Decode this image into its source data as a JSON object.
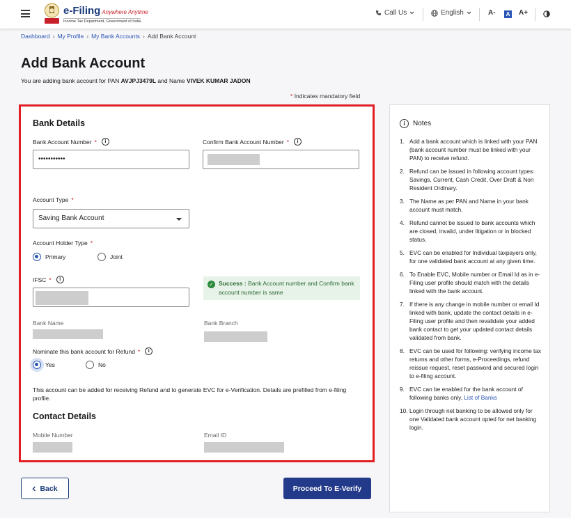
{
  "header": {
    "logo_title": "e-Filing",
    "logo_tagline": "Anywhere Anytime",
    "logo_subtitle": "Income Tax Department, Government of India",
    "call_us": "Call Us",
    "language": "English",
    "font_decrease": "A-",
    "font_normal": "A",
    "font_increase": "A+"
  },
  "breadcrumb": {
    "items": [
      "Dashboard",
      "My Profile",
      "My Bank Accounts"
    ],
    "current": "Add Bank Account"
  },
  "page": {
    "title": "Add Bank Account",
    "intro_prefix": "You are adding bank account for PAN ",
    "pan": "AVJPJ3479L",
    "intro_mid": " and Name ",
    "name": "VIVEK KUMAR JADON",
    "mandatory_note": "Indicates mandatory field"
  },
  "form": {
    "bank_details_title": "Bank Details",
    "account_number_label": "Bank Account Number",
    "account_number_value": "•••••••••••",
    "confirm_account_label": "Confirm Bank Account Number",
    "success_title": "Success :",
    "success_text": " Bank Account number and Confirm bank account number is same",
    "account_type_label": "Account Type",
    "account_type_value": "Saving Bank Account",
    "holder_type_label": "Account Holder Type",
    "holder_primary": "Primary",
    "holder_joint": "Joint",
    "ifsc_label": "IFSC",
    "bank_name_label": "Bank Name",
    "bank_branch_label": "Bank Branch",
    "nominate_label": "Nominate this bank account for Refund",
    "nominate_yes": "Yes",
    "nominate_no": "No",
    "refund_note": "This account can be added for receiving Refund and to generate EVC for e-Verification. Details are prefilled from e-filing profile.",
    "contact_title": "Contact Details",
    "mobile_label": "Mobile Number",
    "email_label": "Email ID"
  },
  "notes": {
    "title": "Notes",
    "items": [
      "Add a bank account which is linked with your PAN (bank account number must be linked with your PAN) to receive refund.",
      "Refund can be issued in following account types: Savings, Current, Cash Credit, Over Draft & Non Resident Ordinary.",
      "The Name as per PAN and Name in your bank account must match.",
      "Refund cannot be issued to bank accounts which are closed, invalid, under litigation or in blocked status.",
      "EVC can be enabled for Individual taxpayers only, for one validated bank account at any given time.",
      "To Enable EVC, Mobile number or Email Id as in e-Filing user profile should match with the details linked with the bank account.",
      "If there is any change in mobile number or email Id linked with bank, update the contact details in e-Filing user profile and then revalidate your added bank contact to get your updated contact details validated from bank.",
      "EVC can be used for following: verifying income tax returns and other forms, e-Proceedings, refund reissue request, reset password and secured login to e-filing account.",
      "EVC can be enabled for the bank account of following banks only. ",
      "Login through net banking to be allowed only for one Validated bank account opted for net banking login."
    ],
    "list_of_banks_link": "List of Banks"
  },
  "actions": {
    "back": "Back",
    "proceed": "Proceed To E-Verify"
  },
  "colors": {
    "highlight_border": "#e21d23",
    "primary": "#233a8a",
    "link": "#2a56b5",
    "success_bg": "#e7f3e8"
  }
}
